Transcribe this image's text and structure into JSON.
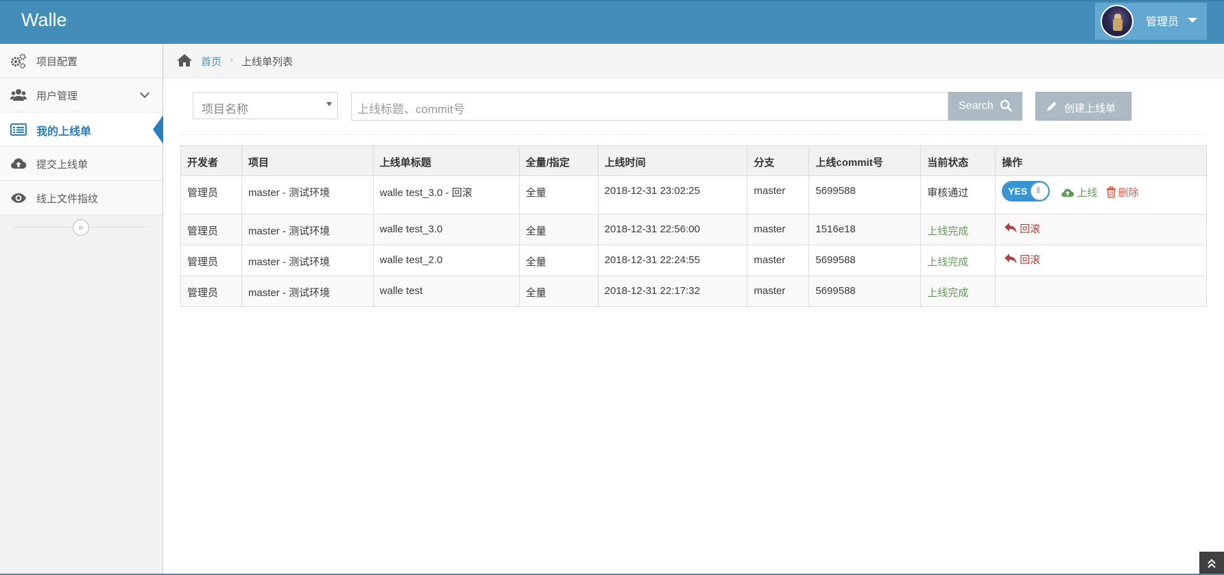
{
  "app": {
    "brand": "Walle"
  },
  "user": {
    "name": "管理员"
  },
  "sidebar": {
    "items": [
      {
        "label": "项目配置",
        "icon": "cogs-icon"
      },
      {
        "label": "用户管理",
        "icon": "users-icon"
      },
      {
        "label": "我的上线单",
        "icon": "list-icon",
        "active": true
      },
      {
        "label": "提交上线单",
        "icon": "cloud-upload-icon"
      },
      {
        "label": "线上文件指纹",
        "icon": "eye-icon"
      }
    ],
    "collapse_glyph": "»"
  },
  "breadcrumb": {
    "home": "首页",
    "current": "上线单列表"
  },
  "toolbar": {
    "project_select_placeholder": "项目名称",
    "search_placeholder": "上线标题、commit号",
    "search_label": "Search",
    "create_label": "创建上线单"
  },
  "table": {
    "headers": [
      "开发者",
      "项目",
      "上线单标题",
      "全量/指定",
      "上线时间",
      "分支",
      "上线commit号",
      "当前状态",
      "操作"
    ],
    "rows": [
      {
        "developer": "管理员",
        "project": "master - 测试环境",
        "title": "walle test_3.0 - 回滚",
        "mode": "全量",
        "time": "2018-12-31 23:02:25",
        "branch": "master",
        "commit": "5699588",
        "status": "审核通过"
      },
      {
        "developer": "管理员",
        "project": "master - 测试环境",
        "title": "walle test_3.0",
        "mode": "全量",
        "time": "2018-12-31 22:56:00",
        "branch": "master",
        "commit": "1516e18",
        "status": "上线完成"
      },
      {
        "developer": "管理员",
        "project": "master - 测试环境",
        "title": "walle test_2.0",
        "mode": "全量",
        "time": "2018-12-31 22:24:55",
        "branch": "master",
        "commit": "5699588",
        "status": "上线完成"
      },
      {
        "developer": "管理员",
        "project": "master - 测试环境",
        "title": "walle test",
        "mode": "全量",
        "time": "2018-12-31 22:17:32",
        "branch": "master",
        "commit": "5699588",
        "status": "上线完成"
      }
    ],
    "actions": {
      "toggle_label": "YES",
      "deploy_label": "上线",
      "delete_label": "删除",
      "rollback_label": "回滚"
    }
  },
  "colors": {
    "navbar": "#438eb9",
    "accent": "#2b7dbc",
    "success": "#629b58",
    "danger": "#dd5a43",
    "rollback": "#a94442",
    "button_grey": "#abbac3"
  }
}
